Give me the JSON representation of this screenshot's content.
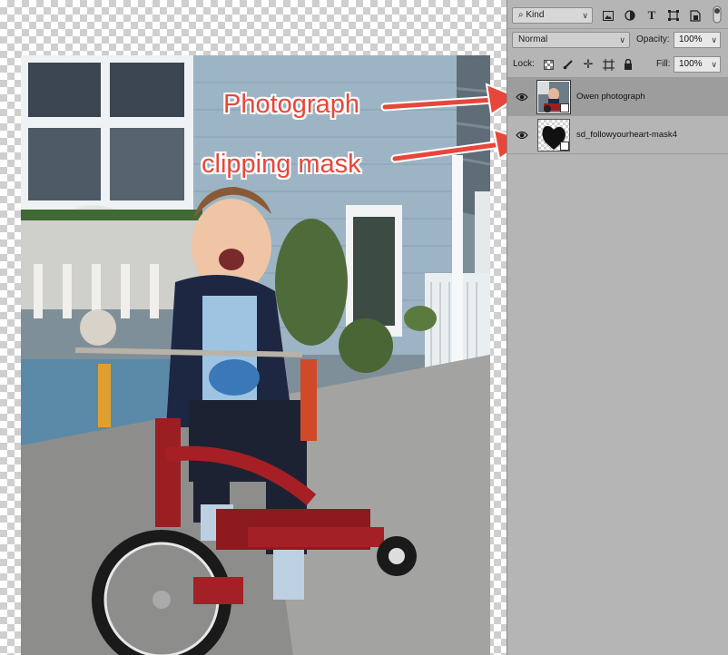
{
  "layers_panel": {
    "filter_kind": "Kind",
    "blend_mode": "Normal",
    "opacity_label": "Opacity:",
    "opacity_value": "100%",
    "lock_label": "Lock:",
    "fill_label": "Fill:",
    "fill_value": "100%",
    "layers": [
      {
        "name": "Owen photograph",
        "selected": true,
        "visible": true
      },
      {
        "name": "sd_followyourheart-mask4",
        "selected": false,
        "visible": true
      }
    ],
    "filter_icons": [
      "image-filter-icon",
      "adjustment-filter-icon",
      "type-filter-icon",
      "shape-filter-icon",
      "smart-object-filter-icon",
      "filter-toggle-icon"
    ],
    "lock_icons": [
      "lock-transparent-icon",
      "lock-image-icon",
      "lock-position-icon",
      "lock-artboard-icon",
      "lock-all-icon"
    ]
  },
  "annotations": {
    "photograph": "Photograph",
    "clipping_mask": "clipping mask",
    "color": "#e8463a"
  }
}
